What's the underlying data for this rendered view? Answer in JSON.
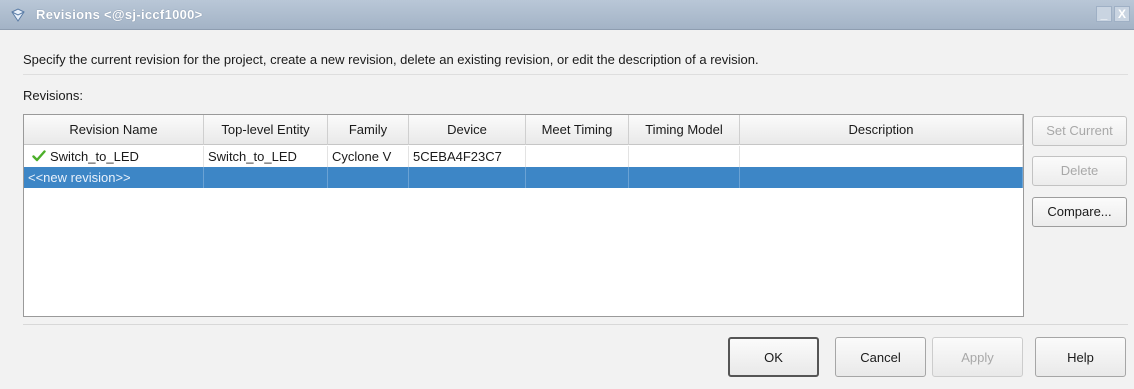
{
  "window": {
    "title": "Revisions <@sj-iccf1000>",
    "minimize_glyph": "_",
    "close_glyph": "X"
  },
  "instructions": "Specify the current revision for the project, create a new revision, delete an existing revision, or edit the description of a revision.",
  "revisions_label": "Revisions:",
  "table": {
    "columns": [
      "Revision Name",
      "Top-level Entity",
      "Family",
      "Device",
      "Meet Timing",
      "Timing Model",
      "Description"
    ],
    "rows": [
      {
        "current": true,
        "icon": "checkmark-icon",
        "cells": [
          "Switch_to_LED",
          "Switch_to_LED",
          "Cyclone V",
          "5CEBA4F23C7",
          "",
          "",
          ""
        ]
      },
      {
        "selected": true,
        "cells": [
          "<<new revision>>",
          "",
          "",
          "",
          "",
          "",
          ""
        ]
      }
    ]
  },
  "side_buttons": {
    "set_current": "Set Current",
    "delete": "Delete",
    "compare": "Compare..."
  },
  "dialog_buttons": {
    "ok": "OK",
    "cancel": "Cancel",
    "apply": "Apply",
    "help": "Help"
  },
  "colors": {
    "selection": "#3d86c6",
    "check": "#4caf2a",
    "titlebar": "#a3b3c6"
  }
}
